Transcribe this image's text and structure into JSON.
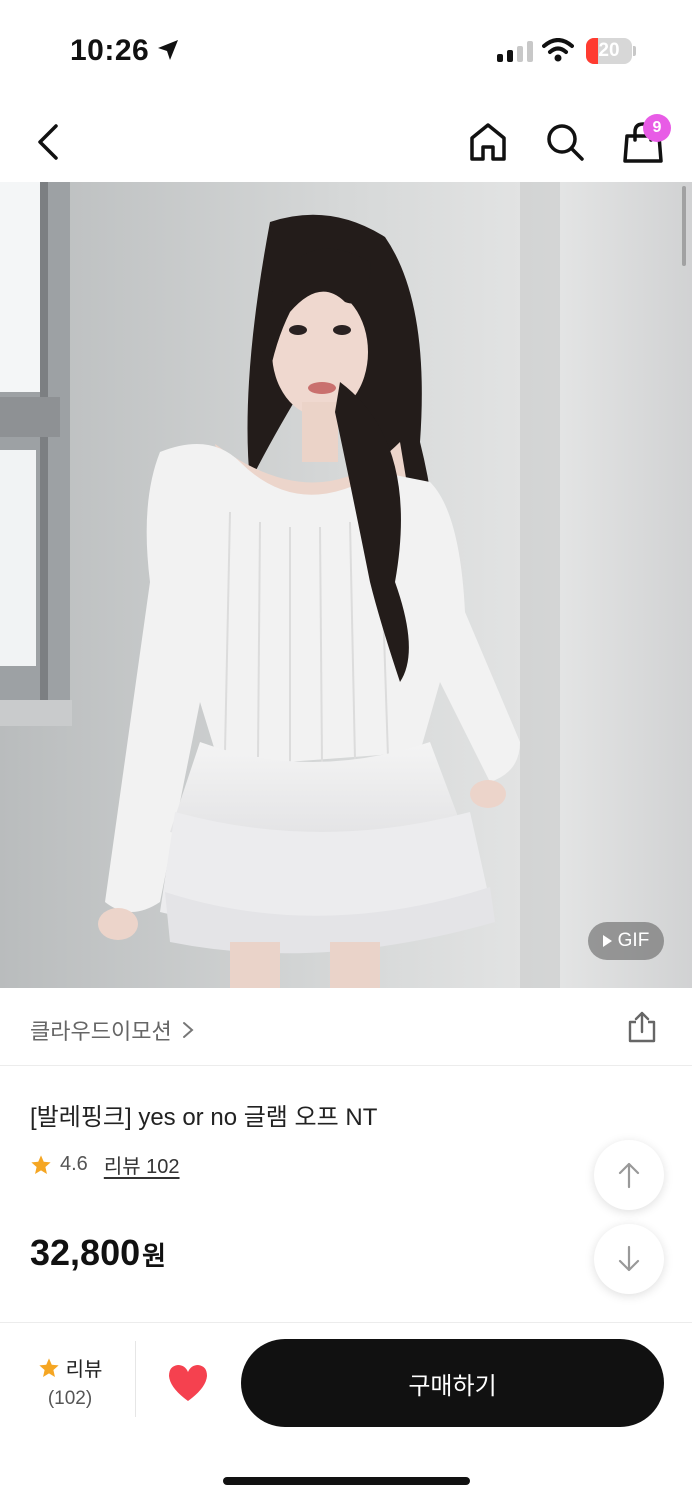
{
  "status_bar": {
    "time": "10:26",
    "battery": "20",
    "colors": {
      "battery_low": "#ff3b30"
    }
  },
  "nav": {
    "back_icon": "chevron-left-icon",
    "home_icon": "home-icon",
    "search_icon": "search-icon",
    "cart_icon": "shopping-bag-icon",
    "cart_count": "9",
    "colors": {
      "badge": "#e85ce6"
    }
  },
  "product_image": {
    "gif_label": "GIF"
  },
  "brand": {
    "name": "클라우드이모션",
    "chevron": "›"
  },
  "product": {
    "title": "[발레핑크] yes or no 글램 오프 NT",
    "rating": "4.6",
    "review_link": "리뷰 102",
    "price": "32,800",
    "price_unit": "원"
  },
  "bottom_bar": {
    "review_label": "리뷰",
    "review_count": "(102)",
    "buy_label": "구매하기",
    "colors": {
      "star": "#f5a623",
      "heart": "#f5414f",
      "buy_bg": "#111111"
    }
  }
}
